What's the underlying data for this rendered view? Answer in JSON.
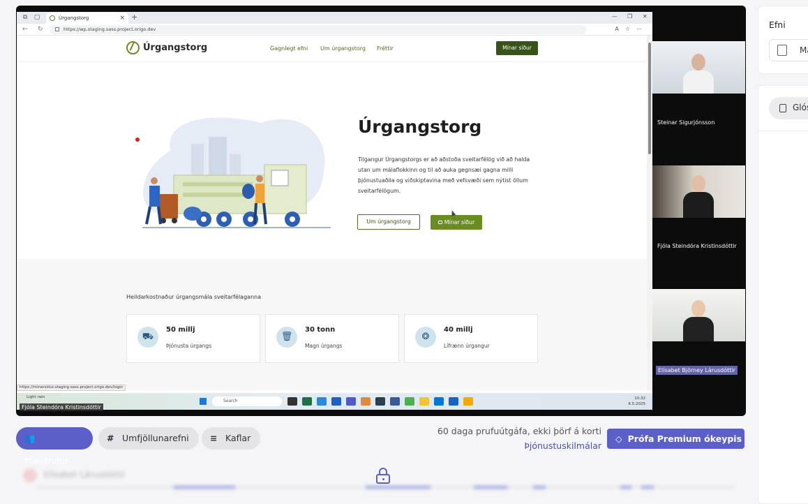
{
  "browser": {
    "tab_title": "Úrgangstorg",
    "url": "https://wp.staging.sass.project.origo.dev",
    "status_url": "https://minarsidur.staging.sass.project.origo.dev/login"
  },
  "site": {
    "logo": "Úrgangstorg",
    "nav": [
      "Gagnlegt efni",
      "Um úrgangstorg",
      "Fréttir"
    ],
    "header_button": "Mínar síður",
    "hero_title": "Úrgangstorg",
    "hero_text": "Tilgangur Úrgangstorgs er að aðstoða sveitarfélög við að halda utan um málaflokkinn og til að auka gegnsæi gagna milli þjónustuaðila og viðskiptavina með vefsvæði sem nýtist öllum sveitarfélögum.",
    "btn_about": "Um úrgangstorg",
    "btn_minar": "Mínar síður",
    "stats_title": "Heildarkostnaður úrgangsmála sveitarfélaganna",
    "stats": [
      {
        "value": "50 millj",
        "label": "Þjónusta úrgangs",
        "icon": "truck-icon"
      },
      {
        "value": "30 tonn",
        "label": "Magn úrgangs",
        "icon": "trash-icon"
      },
      {
        "value": "40 millj",
        "label": "Lífrænn úrgangur",
        "icon": "aperture-icon"
      }
    ]
  },
  "taskbar": {
    "weather": "Light rain",
    "search": "Search",
    "time": "10:32",
    "date": "6.5.2025"
  },
  "presenter": "Fjóla Steindóra Kristinsdóttir",
  "participants": [
    {
      "name": "Steinar Sigurjónsson"
    },
    {
      "name": "Fjóla Steindóra Kristinsdóttir"
    },
    {
      "name": "Elísabet Björney Lárusdóttir"
    }
  ],
  "toolbar": {
    "speakers": "Mælendur",
    "topics": "Umfjöllunarefni",
    "chapters": "Kaflar",
    "trial": "60 daga prufuútgáfa, ekki þörf á korti",
    "terms": "Þjónustuskilmálar",
    "premium": "Prófa Premium ókeypis"
  },
  "blurred": {
    "speaker_name": "Elísabet Lárusdóttir"
  },
  "side": {
    "title": "Efni",
    "file_label": "Ma",
    "glossary_label": "Glós"
  }
}
